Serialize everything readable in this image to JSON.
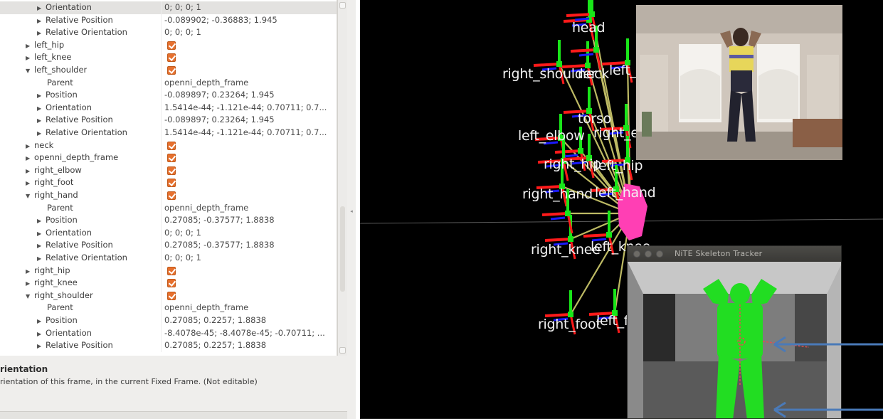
{
  "tree": {
    "rows": [
      {
        "label": "Orientation",
        "value": "0; 0; 0; 1",
        "indent": 2,
        "arrow": "right",
        "selected": true
      },
      {
        "label": "Relative Position",
        "value": "-0.089902; -0.36883; 1.945",
        "indent": 2,
        "arrow": "right"
      },
      {
        "label": "Relative Orientation",
        "value": "0; 0; 0; 1",
        "indent": 2,
        "arrow": "right"
      },
      {
        "label": "left_hip",
        "checkbox": true,
        "indent": 1,
        "arrow": "right"
      },
      {
        "label": "left_knee",
        "checkbox": true,
        "indent": 1,
        "arrow": "right"
      },
      {
        "label": "left_shoulder",
        "checkbox": true,
        "indent": 1,
        "arrow": "down"
      },
      {
        "label": "Parent",
        "value": "openni_depth_frame",
        "indent": 3,
        "arrow": "none"
      },
      {
        "label": "Position",
        "value": "-0.089897; 0.23264; 1.945",
        "indent": 2,
        "arrow": "right"
      },
      {
        "label": "Orientation",
        "value": "1.5414e-44; -1.121e-44; 0.70711; 0.7...",
        "indent": 2,
        "arrow": "right"
      },
      {
        "label": "Relative Position",
        "value": "-0.089897; 0.23264; 1.945",
        "indent": 2,
        "arrow": "right"
      },
      {
        "label": "Relative Orientation",
        "value": "1.5414e-44; -1.121e-44; 0.70711; 0.7...",
        "indent": 2,
        "arrow": "right"
      },
      {
        "label": "neck",
        "checkbox": true,
        "indent": 1,
        "arrow": "right"
      },
      {
        "label": "openni_depth_frame",
        "checkbox": true,
        "indent": 1,
        "arrow": "right"
      },
      {
        "label": "right_elbow",
        "checkbox": true,
        "indent": 1,
        "arrow": "right"
      },
      {
        "label": "right_foot",
        "checkbox": true,
        "indent": 1,
        "arrow": "right"
      },
      {
        "label": "right_hand",
        "checkbox": true,
        "indent": 1,
        "arrow": "down"
      },
      {
        "label": "Parent",
        "value": "openni_depth_frame",
        "indent": 3,
        "arrow": "none"
      },
      {
        "label": "Position",
        "value": "0.27085; -0.37577; 1.8838",
        "indent": 2,
        "arrow": "right"
      },
      {
        "label": "Orientation",
        "value": "0; 0; 0; 1",
        "indent": 2,
        "arrow": "right"
      },
      {
        "label": "Relative Position",
        "value": "0.27085; -0.37577; 1.8838",
        "indent": 2,
        "arrow": "right"
      },
      {
        "label": "Relative Orientation",
        "value": "0; 0; 0; 1",
        "indent": 2,
        "arrow": "right"
      },
      {
        "label": "right_hip",
        "checkbox": true,
        "indent": 1,
        "arrow": "right"
      },
      {
        "label": "right_knee",
        "checkbox": true,
        "indent": 1,
        "arrow": "right"
      },
      {
        "label": "right_shoulder",
        "checkbox": true,
        "indent": 1,
        "arrow": "down"
      },
      {
        "label": "Parent",
        "value": "openni_depth_frame",
        "indent": 3,
        "arrow": "none"
      },
      {
        "label": "Position",
        "value": "0.27085; 0.2257; 1.8838",
        "indent": 2,
        "arrow": "right"
      },
      {
        "label": "Orientation",
        "value": "-8.4078e-45; -8.4078e-45; -0.70711; ...",
        "indent": 2,
        "arrow": "right"
      },
      {
        "label": "Relative Position",
        "value": "0.27085; 0.2257; 1.8838",
        "indent": 2,
        "arrow": "right"
      }
    ]
  },
  "description": {
    "title": "rientation",
    "text": "rientation of this frame, in the current Fixed Frame. (Not editable)"
  },
  "view3d": {
    "frame_labels": [
      {
        "text": "head"
      },
      {
        "text": "right_shoulder"
      },
      {
        "text": "neck"
      },
      {
        "text": "left_shoulder"
      },
      {
        "text": "torso"
      },
      {
        "text": "right_elbow"
      },
      {
        "text": "left_elbow"
      },
      {
        "text": "right_hip"
      },
      {
        "text": "left_hip"
      },
      {
        "text": "right_hand"
      },
      {
        "text": "left_hand"
      },
      {
        "text": "right_knee"
      },
      {
        "text": "left_knee"
      },
      {
        "text": "right_foot"
      },
      {
        "text": "left_foot"
      }
    ]
  },
  "nite_window": {
    "title": "NiTE Skeleton Tracker"
  },
  "colors": {
    "checkbox": "#e6702e",
    "axis_x": "#ff1a1a",
    "axis_y": "#19e619",
    "axis_z": "#1a1aff",
    "link": "#c8c46a",
    "marker": "#ff3fb4",
    "skeleton_fill": "#22dd22",
    "annotation_arrow": "#4a7ab8"
  }
}
